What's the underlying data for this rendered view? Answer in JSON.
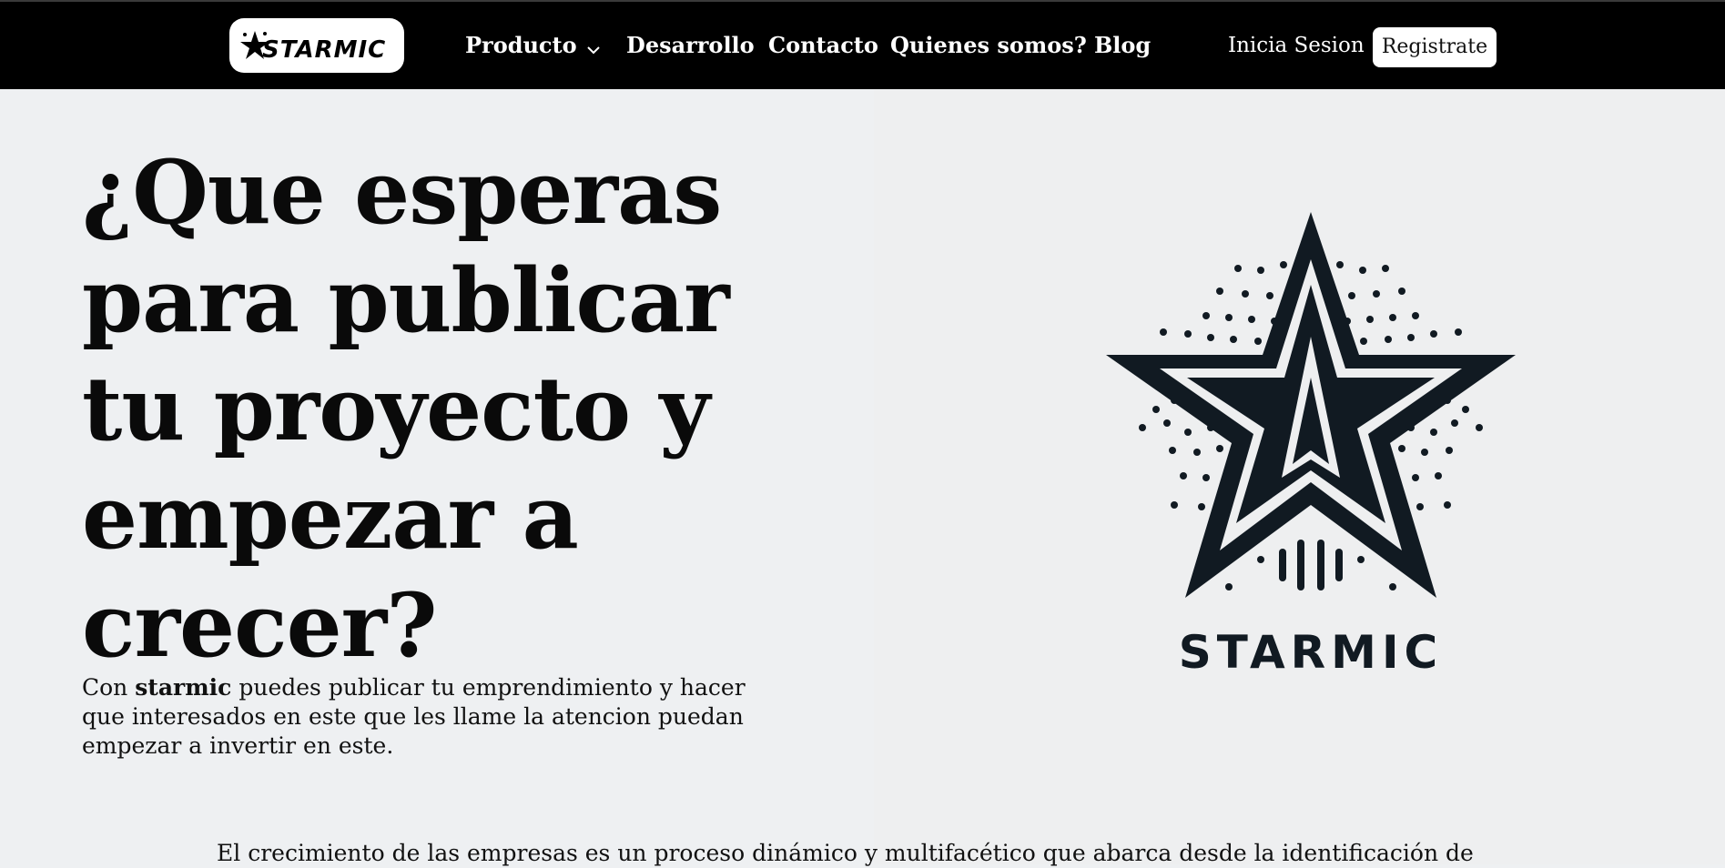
{
  "nav": {
    "logo_text": "STARMIC",
    "items": [
      {
        "label": "Producto",
        "has_dropdown": true
      },
      {
        "label": "Desarrollo"
      },
      {
        "label": "Contacto"
      },
      {
        "label": "Quienes somos?"
      },
      {
        "label": "Blog"
      }
    ],
    "login_label": "Inicia Sesion",
    "register_label": "Registrate"
  },
  "hero": {
    "title": "¿Que esperas para publicar tu proyecto y empezar a crecer?",
    "description_prefix": "Con ",
    "description_brand": "starmic",
    "description_rest": " puedes publicar tu emprendimiento y hacer que interesados en este que les llame la atencion puedan empezar a invertir en este.",
    "image_brand": "STARMIC"
  },
  "intro": {
    "text": "El crecimiento de las empresas es un proceso dinámico y multifacético que abarca desde la identificación de"
  },
  "colors": {
    "nav_bg": "#000000",
    "page_bg": "#eef0f2",
    "star_color": "#111a22"
  },
  "icons": [
    "chevron-down-icon",
    "starmic-star-logo"
  ]
}
